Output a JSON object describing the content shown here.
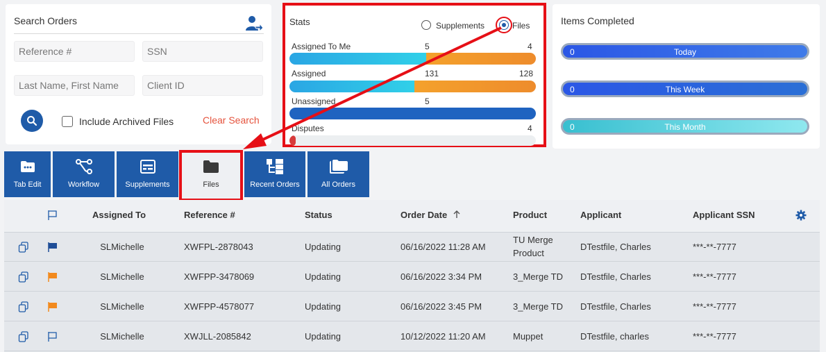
{
  "search": {
    "title": "Search Orders",
    "reference_placeholder": "Reference #",
    "ssn_placeholder": "SSN",
    "name_placeholder": "Last Name, First Name",
    "client_placeholder": "Client ID",
    "include_archived_label": "Include Archived Files",
    "include_archived_checked": false,
    "clear_label": "Clear Search",
    "icons": [
      "user-share-icon",
      "search-icon"
    ]
  },
  "stats": {
    "title": "Stats",
    "options": [
      {
        "label": "Supplements",
        "selected": false
      },
      {
        "label": "Files",
        "selected": true
      }
    ],
    "rows": [
      {
        "label": "Assigned To Me",
        "left_value": "5",
        "right_value": "4"
      },
      {
        "label": "Assigned",
        "left_value": "131",
        "right_value": "128"
      },
      {
        "label": "Unassigned",
        "left_value": "5",
        "right_value": ""
      },
      {
        "label": "Disputes",
        "left_value": "",
        "right_value": "4"
      }
    ]
  },
  "items_completed": {
    "title": "Items Completed",
    "items": [
      {
        "count": "0",
        "label": "Today"
      },
      {
        "count": "0",
        "label": "This Week"
      },
      {
        "count": "0",
        "label": "This Month"
      }
    ]
  },
  "tabs": [
    {
      "label": "Tab Edit",
      "icon": "folder-dots-icon"
    },
    {
      "label": "Workflow",
      "icon": "workflow-icon"
    },
    {
      "label": "Supplements",
      "icon": "supplements-icon"
    },
    {
      "label": "Files",
      "icon": "folder-icon",
      "active": true
    },
    {
      "label": "Recent Orders",
      "icon": "hierarchy-icon"
    },
    {
      "label": "All Orders",
      "icon": "folders-icon"
    }
  ],
  "table": {
    "headers": {
      "assigned_to": "Assigned To",
      "reference": "Reference #",
      "status": "Status",
      "order_date": "Order Date",
      "product": "Product",
      "applicant": "Applicant",
      "applicant_ssn": "Applicant SSN"
    },
    "sort_column": "order_date",
    "sort_direction": "ascending",
    "rows": [
      {
        "flag": "blue",
        "assigned_to": "SLMichelle",
        "reference": "XWFPL-2878043",
        "status": "Updating",
        "order_date": "06/16/2022 11:28 AM",
        "product_line1": "TU Merge",
        "product_line2": "Product",
        "applicant": "DTestfile, Charles",
        "ssn": "***-**-7777"
      },
      {
        "flag": "orange",
        "assigned_to": "SLMichelle",
        "reference": "XWFPP-3478069",
        "status": "Updating",
        "order_date": "06/16/2022 3:34 PM",
        "product_line1": "3_Merge TD",
        "product_line2": "",
        "applicant": "DTestfile, Charles",
        "ssn": "***-**-7777"
      },
      {
        "flag": "orange",
        "assigned_to": "SLMichelle",
        "reference": "XWFPP-4578077",
        "status": "Updating",
        "order_date": "06/16/2022 3:45 PM",
        "product_line1": "3_Merge TD",
        "product_line2": "",
        "applicant": "DTestfile, Charles",
        "ssn": "***-**-7777"
      },
      {
        "flag": "outline",
        "assigned_to": "SLMichelle",
        "reference": "XWJLL-2085842",
        "status": "Updating",
        "order_date": "10/12/2022 11:20 AM",
        "product_line1": "Muppet",
        "product_line2": "",
        "applicant": "DTestfile, charles",
        "ssn": "***-**-7777"
      }
    ]
  },
  "colors": {
    "primary": "#1f5ba8",
    "bar_cyan": "#2ec4e6",
    "bar_orange": "#f29a2e",
    "bar_blue": "#1f63c0",
    "bar_red": "#d73b3b",
    "clear_link": "#e5533d",
    "annotation_red": "#e60f16"
  }
}
